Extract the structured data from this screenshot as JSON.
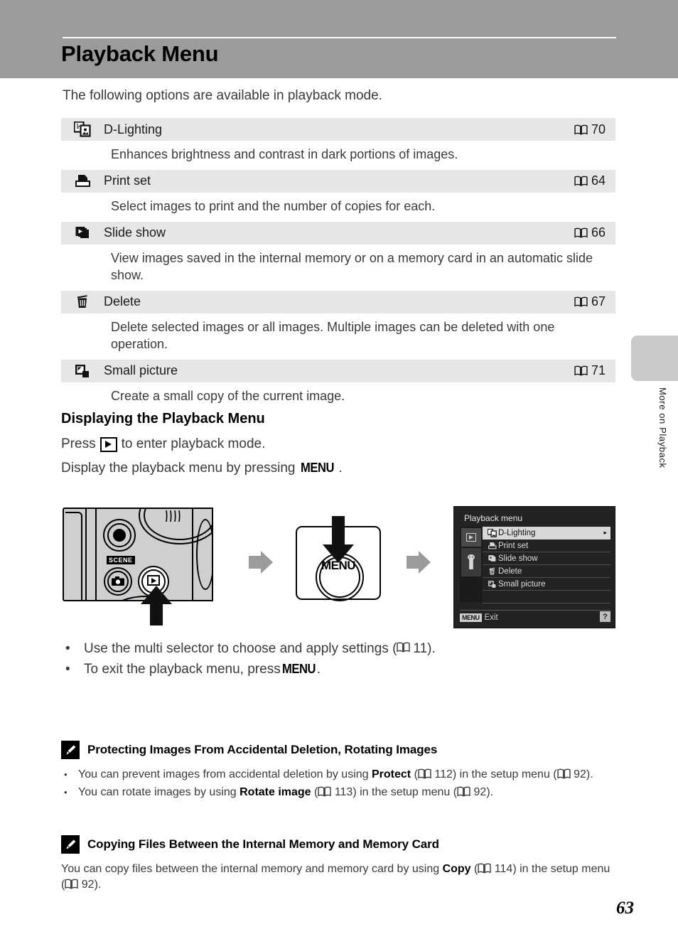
{
  "header": {
    "title": "Playback Menu",
    "band_color": "#9b9b9b"
  },
  "intro": "The following options are available in playback mode.",
  "options_table": {
    "rows": [
      {
        "icon": "d-lighting-icon",
        "label": "D-Lighting",
        "ref_page": "70",
        "description": "Enhances brightness and contrast in dark portions of images."
      },
      {
        "icon": "print-set-icon",
        "label": "Print set",
        "ref_page": "64",
        "description": "Select images to print and the number of copies for each."
      },
      {
        "icon": "slide-show-icon",
        "label": "Slide show",
        "ref_page": "66",
        "description": "View images saved in the internal memory or on a memory card in an automatic slide show."
      },
      {
        "icon": "delete-icon",
        "label": "Delete",
        "ref_page": "67",
        "description": "Delete selected images or all images. Multiple images can be deleted with one operation."
      },
      {
        "icon": "small-picture-icon",
        "label": "Small picture",
        "ref_page": "71",
        "description": "Create a small copy of the current image."
      }
    ]
  },
  "section": {
    "heading": "Displaying the Playback Menu",
    "press_prefix": "Press",
    "press_suffix": "to enter playback mode.",
    "display_prefix": "Display the playback menu by pressing",
    "display_suffix": ".",
    "menu_key": "MENU"
  },
  "illustration": {
    "camera_scene_label": "SCENE",
    "menu_button_label": "MENU",
    "lcd": {
      "title": "Playback menu",
      "items": [
        {
          "icon": "d-lighting-icon",
          "label": "D-Lighting",
          "selected": true,
          "arrow": "▸"
        },
        {
          "icon": "print-set-icon",
          "label": "Print set",
          "selected": false
        },
        {
          "icon": "slide-show-icon",
          "label": "Slide show",
          "selected": false
        },
        {
          "icon": "delete-icon",
          "label": "Delete",
          "selected": false
        },
        {
          "icon": "small-picture-icon",
          "label": "Small picture",
          "selected": false
        }
      ],
      "footer_key": "MENU",
      "footer_label": "Exit",
      "help_badge": "?"
    }
  },
  "bullets": [
    {
      "marker": "•",
      "text_before": "Use the multi selector to choose and apply settings (",
      "ref_page": "11",
      "text_after": ")."
    },
    {
      "marker": "•",
      "text_before": "To exit the playback menu, press ",
      "menu_key": "MENU",
      "text_after": "."
    }
  ],
  "notes": [
    {
      "icon": "pencil-note-icon",
      "title": "Protecting Images From Accidental Deletion, Rotating Images",
      "items": [
        {
          "marker": "•",
          "seg1": "You can prevent images from accidental deletion by using ",
          "bold": "Protect",
          "seg2": " (",
          "ref1": "112",
          "seg3": ") in the setup menu (",
          "ref2": "92",
          "seg4": ")."
        },
        {
          "marker": "•",
          "seg1": "You can rotate images by using ",
          "bold": "Rotate image",
          "seg2": " (",
          "ref1": "113",
          "seg3": ") in the setup menu (",
          "ref2": "92",
          "seg4": ")."
        }
      ]
    },
    {
      "icon": "pencil-note-icon",
      "title": "Copying Files Between the Internal Memory and Memory Card",
      "paragraph": {
        "seg1": "You can copy files between the internal memory and memory card by using ",
        "bold": "Copy",
        "seg2": " (",
        "ref1": "114",
        "seg3": ") in the setup menu (",
        "ref2": "92",
        "seg4": ")."
      }
    }
  ],
  "side_tab": {
    "label": "More on Playback",
    "color": "#c9c9c9"
  },
  "page_number": "63"
}
